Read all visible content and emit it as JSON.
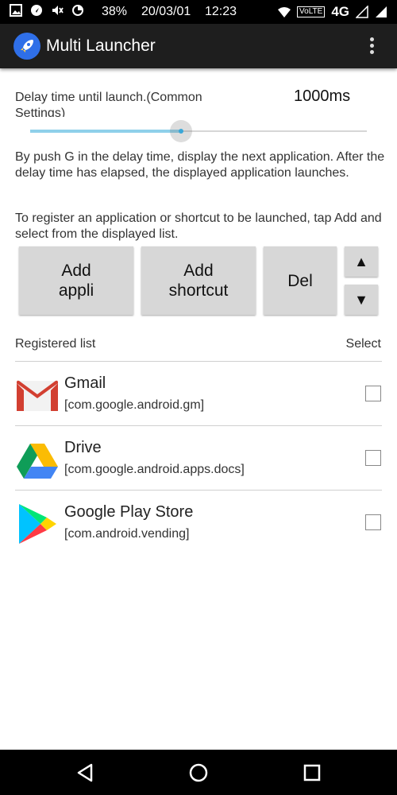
{
  "status_bar": {
    "battery": "38%",
    "date": "20/03/01",
    "time": "12:23",
    "network_badge": "VoLTE",
    "network_type": "4G"
  },
  "app_bar": {
    "title": "Multi Launcher",
    "icon": "rocket-icon",
    "menu_icon": "overflow-menu-icon"
  },
  "settings": {
    "delay_label": "Delay time until launch.(Common Settings)",
    "delay_value": "1000ms",
    "slider_fraction": 0.447,
    "description_1": "By push G in the delay time, display the next application. After the delay time has elapsed, the displayed application launches.",
    "description_2": "To register an application or shortcut to be launched, tap Add and select from the displayed list."
  },
  "buttons": {
    "add_appli_line1": "Add",
    "add_appli_line2": "appli",
    "add_shortcut_line1": "Add",
    "add_shortcut_line2": "shortcut",
    "del": "Del",
    "up": "▲",
    "down": "▼"
  },
  "list": {
    "header": "Registered list",
    "select_header": "Select",
    "items": [
      {
        "name": "Gmail",
        "package": "[com.google.android.gm]",
        "icon": "gmail-icon",
        "checked": false
      },
      {
        "name": "Drive",
        "package": "[com.google.android.apps.docs]",
        "icon": "google-drive-icon",
        "checked": false
      },
      {
        "name": "Google Play Store",
        "package": "[com.android.vending]",
        "icon": "google-play-store-icon",
        "checked": false
      }
    ]
  },
  "colors": {
    "app_bar": "#1e1e1e",
    "button_bg": "#d7d7d7",
    "slider_fill": "#8fd0ea",
    "slider_thumb": "#3aa7d8"
  }
}
